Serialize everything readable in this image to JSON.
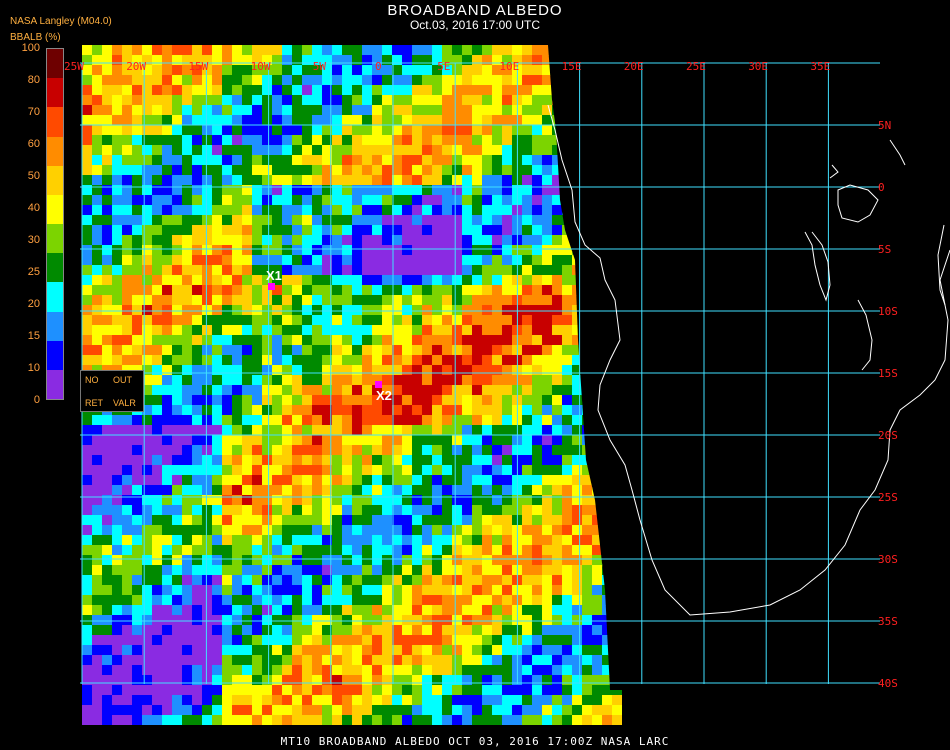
{
  "header": {
    "title": "BROADBAND ALBEDO",
    "subtitle": "Oct.03, 2016 17:00 UTC",
    "producer": "NASA Langley (M04.0)"
  },
  "legend": {
    "title": "BBALB (%)",
    "ticks": [
      "100",
      "80",
      "70",
      "60",
      "50",
      "40",
      "30",
      "25",
      "20",
      "15",
      "10",
      "0"
    ],
    "colors": [
      "#6e0000",
      "#c80000",
      "#ff4a00",
      "#ff8c00",
      "#ffd000",
      "#ffff00",
      "#7cd400",
      "#008a00",
      "#00ffff",
      "#1e90ff",
      "#0000ff",
      "#8a2be2"
    ]
  },
  "nodata_box": {
    "no": "NO",
    "out": "OUT",
    "ret": "RET",
    "valr": "VALR"
  },
  "map": {
    "lon_labels": [
      "25W",
      "20W",
      "15W",
      "10W",
      "5W",
      "0",
      "5E",
      "10E",
      "15E",
      "20E",
      "25E",
      "30E",
      "35E"
    ],
    "lat_labels": [
      "5N",
      "0",
      "5S",
      "10S",
      "15S",
      "20S",
      "25S",
      "30S",
      "35S",
      "40S"
    ],
    "grid_color": "#40e0ff",
    "label_color": "#ff2020"
  },
  "markers": [
    {
      "label": "X1"
    },
    {
      "label": "X2"
    }
  ],
  "footer": "MT10  BROADBAND ALBEDO   OCT 03, 2016 17:00Z   NASA LARC"
}
